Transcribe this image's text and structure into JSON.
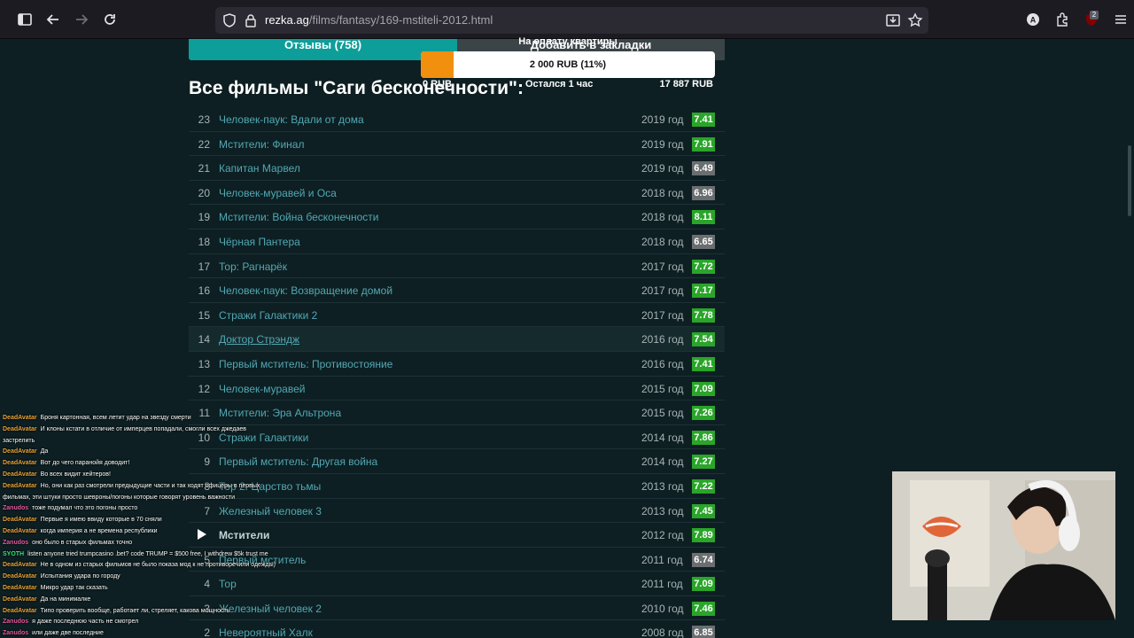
{
  "browser": {
    "url_domain": "rezka.ag",
    "url_path": "/films/fantasy/169-mstiteli-2012.html",
    "extension_badge": "2"
  },
  "tabs": {
    "reviews": "Отзывы (758)",
    "bookmarks": "Добавить в закладки"
  },
  "donation": {
    "label": "На оплату квартиры",
    "amount": "2 000 RUB (11%)",
    "progress": 0.11,
    "min": "0 RUB",
    "time_left": "Остался 1 час",
    "goal": "17 887 RUB",
    "bar_color": "#f0900e"
  },
  "section_title": "Все фильмы \"Саги бесконечности\":",
  "films": [
    {
      "num": "23",
      "title": "Человек-паук: Вдали от дома",
      "year": "2019 год",
      "rating": "7.41",
      "color": "green"
    },
    {
      "num": "22",
      "title": "Мстители: Финал",
      "year": "2019 год",
      "rating": "7.91",
      "color": "green"
    },
    {
      "num": "21",
      "title": "Капитан Марвел",
      "year": "2019 год",
      "rating": "6.49",
      "color": "gray"
    },
    {
      "num": "20",
      "title": "Человек-муравей и Оса",
      "year": "2018 год",
      "rating": "6.96",
      "color": "gray"
    },
    {
      "num": "19",
      "title": "Мстители: Война бесконечности",
      "year": "2018 год",
      "rating": "8.11",
      "color": "green"
    },
    {
      "num": "18",
      "title": "Чёрная Пантера",
      "year": "2018 год",
      "rating": "6.65",
      "color": "gray"
    },
    {
      "num": "17",
      "title": "Тор: Рагнарёк",
      "year": "2017 год",
      "rating": "7.72",
      "color": "green"
    },
    {
      "num": "16",
      "title": "Человек-паук: Возвращение домой",
      "year": "2017 год",
      "rating": "7.17",
      "color": "green"
    },
    {
      "num": "15",
      "title": "Стражи Галактики 2",
      "year": "2017 год",
      "rating": "7.78",
      "color": "green"
    },
    {
      "num": "14",
      "title": "Доктор Стрэндж",
      "year": "2016 год",
      "rating": "7.54",
      "color": "green",
      "hover": true
    },
    {
      "num": "13",
      "title": "Первый мститель: Противостояние",
      "year": "2016 год",
      "rating": "7.41",
      "color": "green"
    },
    {
      "num": "12",
      "title": "Человек-муравей",
      "year": "2015 год",
      "rating": "7.09",
      "color": "green"
    },
    {
      "num": "11",
      "title": "Мстители: Эра Альтрона",
      "year": "2015 год",
      "rating": "7.26",
      "color": "green"
    },
    {
      "num": "10",
      "title": "Стражи Галактики",
      "year": "2014 год",
      "rating": "7.86",
      "color": "green"
    },
    {
      "num": "9",
      "title": "Первый мститель: Другая война",
      "year": "2014 год",
      "rating": "7.27",
      "color": "green"
    },
    {
      "num": "8",
      "title": "Тор 2: Царство тьмы",
      "year": "2013 год",
      "rating": "7.22",
      "color": "green"
    },
    {
      "num": "7",
      "title": "Железный человек 3",
      "year": "2013 год",
      "rating": "7.45",
      "color": "green"
    },
    {
      "num": "",
      "title": "Мстители",
      "year": "2012 год",
      "rating": "7.89",
      "color": "green",
      "current": true
    },
    {
      "num": "5",
      "title": "Первый мститель",
      "year": "2011 год",
      "rating": "6.74",
      "color": "gray"
    },
    {
      "num": "4",
      "title": "Тор",
      "year": "2011 год",
      "rating": "7.09",
      "color": "green"
    },
    {
      "num": "3",
      "title": "Железный человек 2",
      "year": "2010 год",
      "rating": "7.46",
      "color": "green"
    },
    {
      "num": "2",
      "title": "Невероятный Халк",
      "year": "2008 год",
      "rating": "6.85",
      "color": "gray"
    }
  ],
  "chat": [
    {
      "user": "DeadAvatar",
      "color": "#e8a33a",
      "text": "Броня картонная, всем летит удар на звезду смерти"
    },
    {
      "user": "DeadAvatar",
      "color": "#e8a33a",
      "text": "И клоны кстати в отличие от имперцев попадали, смогли всех джедаев"
    },
    {
      "user": "",
      "color": "#e8a33a",
      "text": "застрелить"
    },
    {
      "user": "DeadAvatar",
      "color": "#e8a33a",
      "text": "Да"
    },
    {
      "user": "DeadAvatar",
      "color": "#e8a33a",
      "text": "Вот до чего паранойя доводит!"
    },
    {
      "user": "DeadAvatar",
      "color": "#e8a33a",
      "text": "Во всех видит хейтеров!"
    },
    {
      "user": "DeadAvatar",
      "color": "#e8a33a",
      "text": "Но, они как раз смотрели предыдущие части и так ходят офицеры в первых"
    },
    {
      "user": "",
      "color": "#e8a33a",
      "text": "фильмах, эти штуки просто шевроны/погоны которые говорят уровень важности"
    },
    {
      "user": "Zanudos",
      "color": "#e85aa0",
      "text": "тоже подумал что это погоны просто"
    },
    {
      "user": "DeadAvatar",
      "color": "#e8a33a",
      "text": "Первые я имею ввиду которые в 70 сняли"
    },
    {
      "user": "DeadAvatar",
      "color": "#e8a33a",
      "text": "когда империя а не времена республики"
    },
    {
      "user": "Zanudos",
      "color": "#e85aa0",
      "text": "оно было в старых фильмах точно"
    },
    {
      "user": "SYOTH",
      "color": "#3ae87a",
      "text": "listen anyone tried trumpcasino .bet? code TRUMP = $500 free, I withdrew $5k trust me"
    },
    {
      "user": "DeadAvatar",
      "color": "#e8a33a",
      "text": "Не в одном из старых фильмов не было показа мод к не противоречили одежды)"
    },
    {
      "user": "DeadAvatar",
      "color": "#e8a33a",
      "text": "Испытания удара по городу"
    },
    {
      "user": "DeadAvatar",
      "color": "#e8a33a",
      "text": "Микро удар так сказать"
    },
    {
      "user": "DeadAvatar",
      "color": "#e8a33a",
      "text": "Да на минималке"
    },
    {
      "user": "DeadAvatar",
      "color": "#e8a33a",
      "text": "Типо проверить вообще, работает ли, стреляет, какова мощность"
    },
    {
      "user": "Zanudos",
      "color": "#e85aa0",
      "text": "я даже последнюю часть не смотрел"
    },
    {
      "user": "Zanudos",
      "color": "#e85aa0",
      "text": "или даже две последние"
    }
  ]
}
